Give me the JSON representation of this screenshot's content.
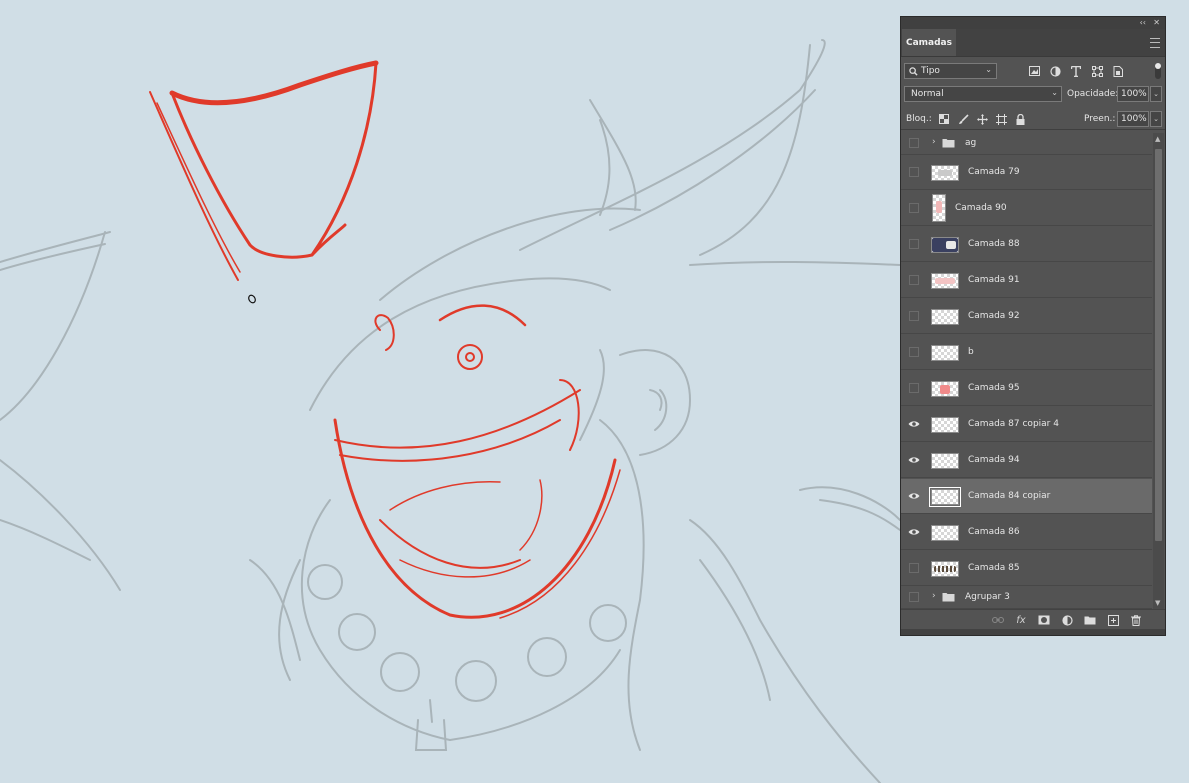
{
  "panel": {
    "title": "Camadas",
    "collapse_glyph": "‹‹",
    "close_glyph": "✕",
    "filter": {
      "kind": "Tipo"
    },
    "blend_mode": "Normal",
    "opacity_label": "Opacidade:",
    "opacity_value": "100%",
    "lock_label": "Bloq.:",
    "fill_label": "Preen.:",
    "fill_value": "100%",
    "footer_fx": "fx"
  },
  "layers": [
    {
      "name": "ag",
      "type": "group",
      "visible": false
    },
    {
      "name": "Camada 79",
      "type": "layer",
      "visible": false,
      "thumb": "sketch"
    },
    {
      "name": "Camada 90",
      "type": "layer",
      "visible": false,
      "thumb": "tall-red"
    },
    {
      "name": "Camada 88",
      "type": "layer",
      "visible": false,
      "thumb": "dark"
    },
    {
      "name": "Camada 91",
      "type": "layer",
      "visible": false,
      "thumb": "pink"
    },
    {
      "name": "Camada 92",
      "type": "layer",
      "visible": false,
      "thumb": "empty"
    },
    {
      "name": "b",
      "type": "layer",
      "visible": false,
      "thumb": "empty"
    },
    {
      "name": "Camada 95",
      "type": "layer",
      "visible": false,
      "thumb": "red-face"
    },
    {
      "name": "Camada 87 copiar 4",
      "type": "layer",
      "visible": true,
      "thumb": "empty"
    },
    {
      "name": "Camada 94",
      "type": "layer",
      "visible": true,
      "thumb": "empty"
    },
    {
      "name": "Camada 84 copiar",
      "type": "layer",
      "visible": true,
      "selected": true,
      "thumb": "empty"
    },
    {
      "name": "Camada 86",
      "type": "layer",
      "visible": true,
      "thumb": "empty"
    },
    {
      "name": "Camada 85",
      "type": "layer",
      "visible": false,
      "thumb": "dots"
    },
    {
      "name": "Agrupar 3",
      "type": "group",
      "visible": false
    }
  ],
  "colors": {
    "canvas_bg": "#d0dee6",
    "sketch_gray": "#a9b4b9",
    "ink_red": "#e03a2a",
    "panel_bg": "#535353",
    "selected_row": "#6a6a6a"
  }
}
